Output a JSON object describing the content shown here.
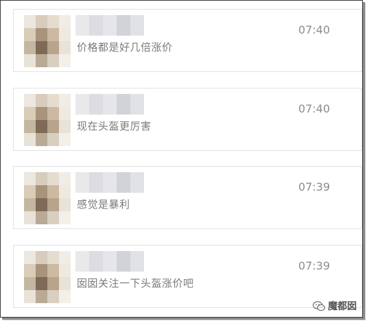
{
  "messages": [
    {
      "message": "价格都是好几倍涨价",
      "time": "07:40"
    },
    {
      "message": "现在头盔更厉害",
      "time": "07:40"
    },
    {
      "message": "感觉是暴利",
      "time": "07:39"
    },
    {
      "message": "囡囡关注一下头盔涨价吧",
      "time": "07:39"
    }
  ],
  "watermark": {
    "text": "魔都囡",
    "icon": "wechat-icon"
  },
  "colors": {
    "avatar_mosaic": [
      "#ece7df",
      "#d8ccbd",
      "#e4dccf",
      "#f1ede6",
      "#d9ccb8",
      "#a8947b",
      "#cbb9a1",
      "#efe9df",
      "#c5b6a0",
      "#7e6a56",
      "#b7a48b",
      "#e9e2d7",
      "#e8e2d8",
      "#b9aa96",
      "#d9cfc1",
      "#f3f0ea"
    ],
    "name_mosaic": [
      "#e9e9ec",
      "#dcdde2",
      "#e6e6ea",
      "#d2d3d8",
      "#e1e2e6"
    ]
  }
}
